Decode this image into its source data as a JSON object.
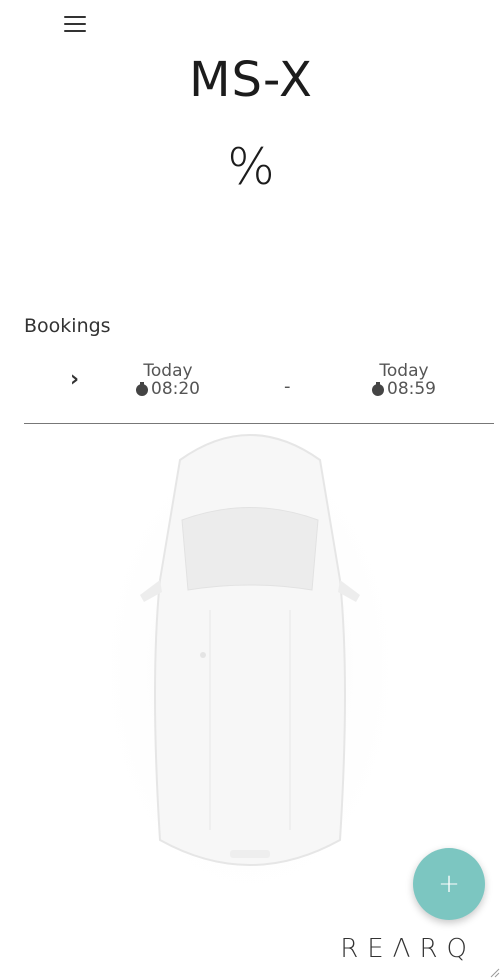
{
  "header": {
    "menu_icon": "hamburger-menu-icon",
    "vehicle_name": "MS-X",
    "charge_level": "%"
  },
  "bookings": {
    "heading": "Bookings",
    "current": {
      "start_day": "Today",
      "start_time": "08:20",
      "separator": "-",
      "end_day": "Today",
      "end_time": "08:59"
    }
  },
  "fab": {
    "label": "+"
  },
  "brand": {
    "logo_text": "REΛRQ"
  },
  "colors": {
    "accent": "#7cc6c1",
    "divider": "#777777"
  }
}
